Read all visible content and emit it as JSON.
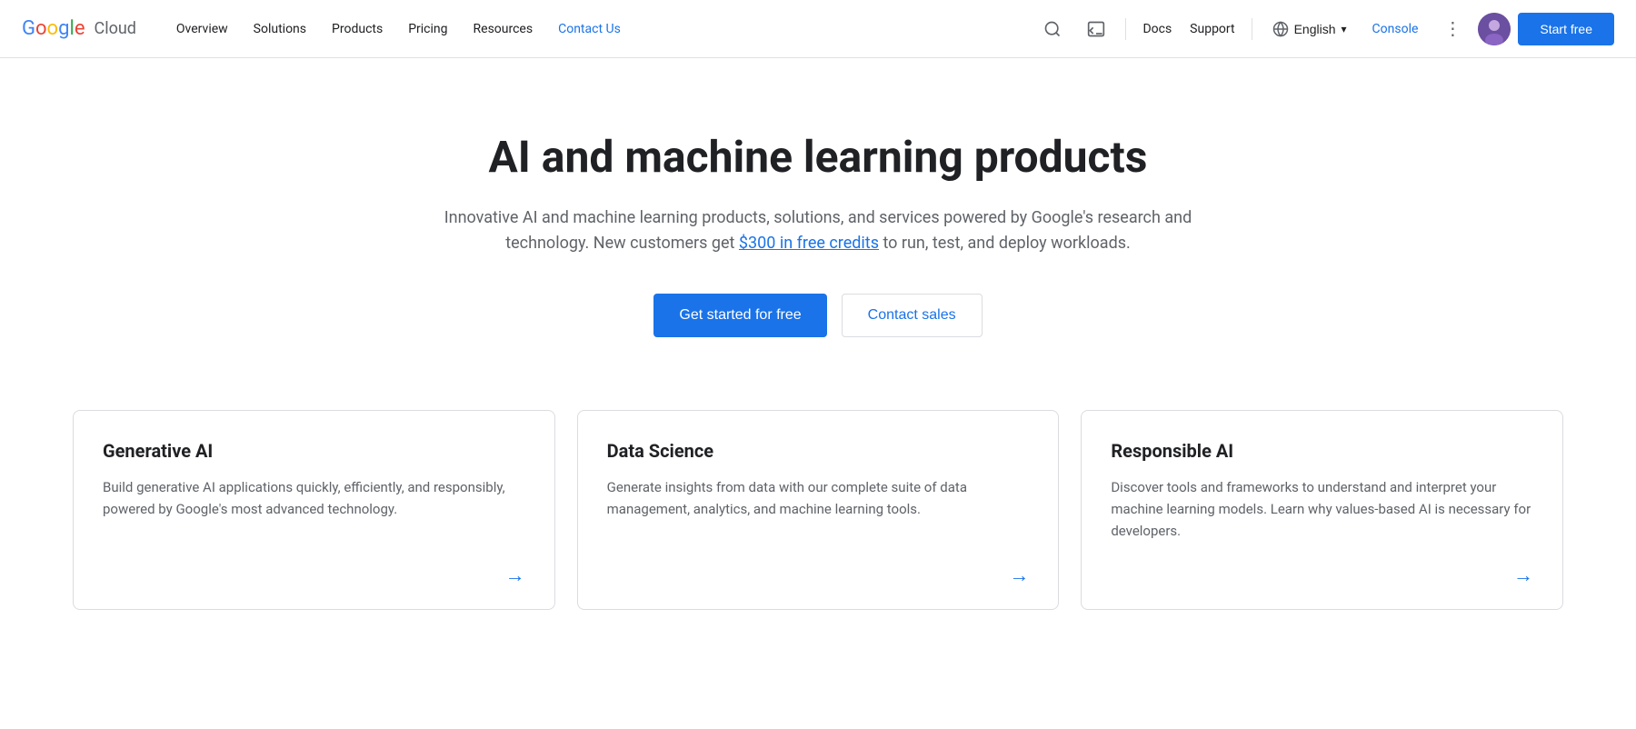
{
  "navbar": {
    "logo_text": "Google",
    "cloud_text": "Cloud",
    "nav_items": [
      {
        "label": "Overview",
        "active": false
      },
      {
        "label": "Solutions",
        "active": false
      },
      {
        "label": "Products",
        "active": false
      },
      {
        "label": "Pricing",
        "active": false
      },
      {
        "label": "Resources",
        "active": false
      },
      {
        "label": "Contact Us",
        "active": true
      }
    ],
    "docs_label": "Docs",
    "support_label": "Support",
    "language_label": "English",
    "console_label": "Console",
    "more_icon": "⋮",
    "start_free_label": "Start free"
  },
  "hero": {
    "title": "AI and machine learning products",
    "subtitle_before": "Innovative AI and machine learning products, solutions, and services powered by Google's research and technology. New customers get ",
    "subtitle_link": "$300 in free credits",
    "subtitle_after": " to run, test, and deploy workloads.",
    "btn_primary": "Get started for free",
    "btn_secondary": "Contact sales"
  },
  "cards": [
    {
      "title": "Generative AI",
      "description": "Build generative AI applications quickly, efficiently, and responsibly, powered by Google's most advanced technology.",
      "arrow": "→"
    },
    {
      "title": "Data Science",
      "description": "Generate insights from data with our complete suite of data management, analytics, and machine learning tools.",
      "arrow": "→"
    },
    {
      "title": "Responsible AI",
      "description": "Discover tools and frameworks to understand and interpret your machine learning models. Learn why values-based AI is necessary for developers.",
      "arrow": "→"
    }
  ]
}
